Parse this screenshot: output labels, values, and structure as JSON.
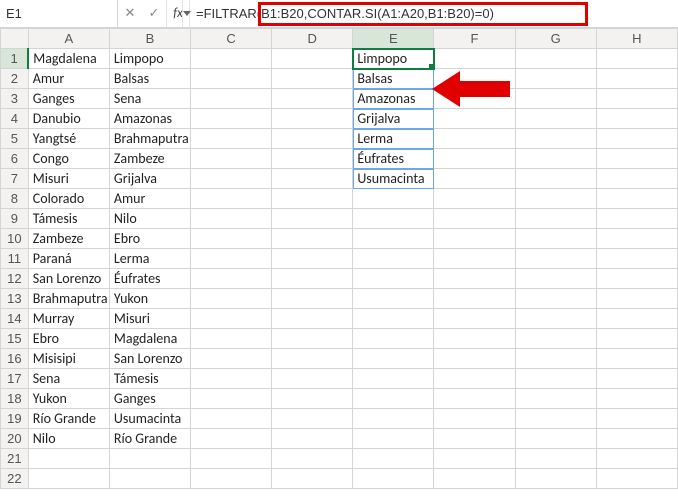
{
  "namebox": {
    "value": "E1"
  },
  "formula_bar": {
    "cancel_glyph": "✕",
    "enter_glyph": "✓",
    "fx_label": "fx",
    "formula": "=FILTRAR(B1:B20,CONTAR.SI(A1:A20,B1:B20)=0)"
  },
  "columns": [
    "A",
    "B",
    "C",
    "D",
    "E",
    "F",
    "G",
    "H"
  ],
  "rows": [
    "1",
    "2",
    "3",
    "4",
    "5",
    "6",
    "7",
    "8",
    "9",
    "10",
    "11",
    "12",
    "13",
    "14",
    "15",
    "16",
    "17",
    "18",
    "19",
    "20",
    "21",
    "22"
  ],
  "cells": {
    "A1": "Magdalena",
    "B1": "Limpopo",
    "A2": "Amur",
    "B2": "Balsas",
    "A3": "Ganges",
    "B3": "Sena",
    "A4": "Danubio",
    "B4": "Amazonas",
    "A5": "Yangtsé",
    "B5": "Brahmaputra",
    "A6": "Congo",
    "B6": "Zambeze",
    "A7": "Misuri",
    "B7": "Grijalva",
    "A8": "Colorado",
    "B8": "Amur",
    "A9": "Támesis",
    "B9": "Nilo",
    "A10": "Zambeze",
    "B10": "Ebro",
    "A11": "Paraná",
    "B11": "Lerma",
    "A12": "San Lorenzo",
    "B12": "Éufrates",
    "A13": "Brahmaputra",
    "B13": "Yukon",
    "A14": "Murray",
    "B14": "Misuri",
    "A15": "Ebro",
    "B15": "Magdalena",
    "A16": "Misisipi",
    "B16": "San Lorenzo",
    "A17": "Sena",
    "B17": "Támesis",
    "A18": "Yukon",
    "B18": "Ganges",
    "A19": "Río Grande",
    "B19": "Usumacinta",
    "A20": "Nilo",
    "B20": "Río Grande",
    "E1": "Limpopo",
    "E2": "Balsas",
    "E3": "Amazonas",
    "E4": "Grijalva",
    "E5": "Lerma",
    "E6": "Éufrates",
    "E7": "Usumacinta"
  },
  "active_cell": "E1",
  "active_col": "E",
  "active_row": "1",
  "spill_range": [
    "E2",
    "E3",
    "E4",
    "E5",
    "E6",
    "E7"
  ]
}
